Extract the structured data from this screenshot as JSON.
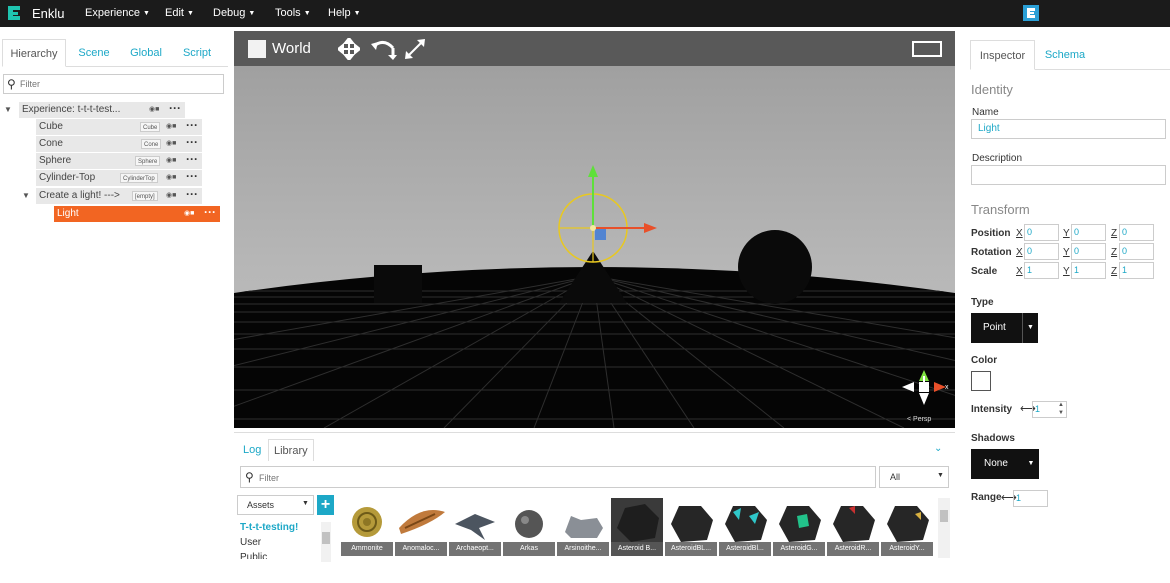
{
  "app": {
    "name": "Enklu"
  },
  "menu": [
    {
      "label": "Experience"
    },
    {
      "label": "Edit"
    },
    {
      "label": "Debug"
    },
    {
      "label": "Tools"
    },
    {
      "label": "Help"
    }
  ],
  "left_panel": {
    "tabs": [
      {
        "label": "Hierarchy"
      },
      {
        "label": "Scene"
      },
      {
        "label": "Global"
      },
      {
        "label": "Script"
      }
    ],
    "filter_placeholder": "Filter",
    "tree": [
      {
        "label": "Experience: t-t-t-test...",
        "tag": ""
      },
      {
        "label": "Cube",
        "tag": "Cube"
      },
      {
        "label": "Cone",
        "tag": "Cone"
      },
      {
        "label": "Sphere",
        "tag": "Sphere"
      },
      {
        "label": "Cylinder-Top",
        "tag": "CylinderTop"
      },
      {
        "label": "Create a light! --->",
        "tag": "[empty]"
      },
      {
        "label": "Light",
        "tag": ""
      }
    ]
  },
  "viewport": {
    "space_label": "World",
    "gizmo_label": "< Persp"
  },
  "bottom_panel": {
    "tabs": [
      {
        "label": "Log"
      },
      {
        "label": "Library"
      }
    ],
    "filter_placeholder": "Filter",
    "type_select": "All",
    "source_select": "Assets",
    "folders": [
      {
        "label": "T-t-t-testing!"
      },
      {
        "label": "User"
      },
      {
        "label": "Public"
      }
    ],
    "assets": [
      {
        "name": "Ammonite"
      },
      {
        "name": "Anomaloc..."
      },
      {
        "name": "Archaeopt..."
      },
      {
        "name": "Arkas"
      },
      {
        "name": "Arsinoithe..."
      },
      {
        "name": "Asteroid B..."
      },
      {
        "name": "AsteroidBL..."
      },
      {
        "name": "AsteroidBl..."
      },
      {
        "name": "AsteroidG..."
      },
      {
        "name": "AsteroidR..."
      },
      {
        "name": "AsteroidY..."
      }
    ]
  },
  "inspector": {
    "tabs": [
      {
        "label": "Inspector"
      },
      {
        "label": "Schema"
      }
    ],
    "identity_title": "Identity",
    "name_label": "Name",
    "name_value": "Light",
    "description_label": "Description",
    "description_value": "",
    "transform_title": "Transform",
    "position_label": "Position",
    "rotation_label": "Rotation",
    "scale_label": "Scale",
    "axes": {
      "x": "X",
      "y": "Y",
      "z": "Z"
    },
    "position": {
      "x": "0",
      "y": "0",
      "z": "0"
    },
    "rotation": {
      "x": "0",
      "y": "0",
      "z": "0"
    },
    "scale": {
      "x": "1",
      "y": "1",
      "z": "1"
    },
    "type_label": "Type",
    "type_value": "Point",
    "color_label": "Color",
    "intensity_label": "Intensity",
    "intensity_value": "1",
    "shadows_label": "Shadows",
    "shadows_value": "None",
    "range_label": "Range",
    "range_value": "1"
  },
  "colors": {
    "accent": "#1da8c7",
    "selection": "#f26522",
    "topbar": "#1b1b1b"
  }
}
